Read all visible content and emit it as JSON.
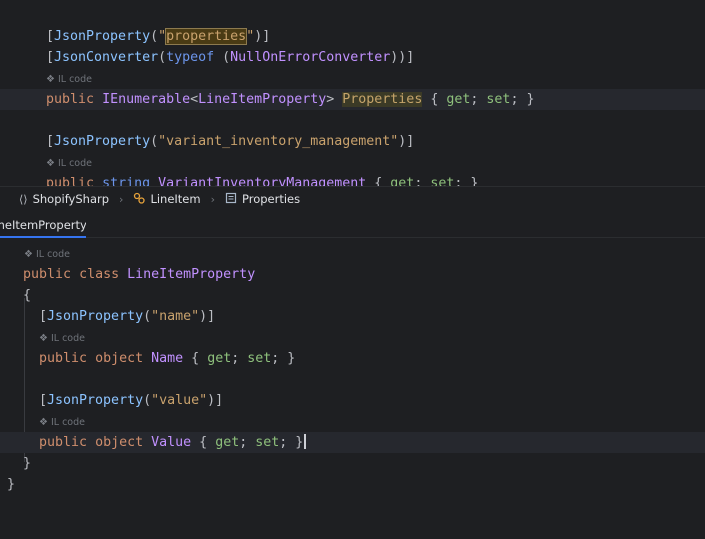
{
  "top_editor": {
    "line1": {
      "attr": "JsonProperty",
      "str_before": "\"",
      "str_hl": "properties",
      "str_after": "\""
    },
    "line2": {
      "attr": "JsonConverter",
      "typeof": "typeof",
      "type": "NullOnErrorConverter"
    },
    "lens1": "IL code",
    "line3": {
      "public": "public",
      "type": "IEnumerable",
      "generic": "LineItemProperty",
      "name": "Properties",
      "get": "get",
      "set": "set"
    },
    "line4": {
      "attr": "JsonProperty",
      "str": "\"variant_inventory_management\""
    },
    "lens2": "IL code",
    "line5": {
      "public": "public",
      "type": "string",
      "name": "VariantInventoryManagement",
      "get": "get",
      "set": "set"
    }
  },
  "breadcrumb": {
    "items": [
      {
        "label": "ShopifySharp",
        "icon": "namespace-icon"
      },
      {
        "label": "LineItem",
        "icon": "class-icon"
      },
      {
        "label": "Properties",
        "icon": "property-icon"
      }
    ],
    "separator": "›"
  },
  "tab": {
    "label": "LineItemProperty.cs",
    "close": "×"
  },
  "bottom_editor": {
    "lens_class": "IL code",
    "class_line": {
      "public": "public",
      "class": "class",
      "name": "LineItemProperty"
    },
    "open_brace": "{",
    "attr1": {
      "attr": "JsonProperty",
      "str": "\"name\""
    },
    "lens1": "IL code",
    "prop1": {
      "public": "public",
      "object": "object",
      "name": "Name",
      "get": "get",
      "set": "set"
    },
    "attr2": {
      "attr": "JsonProperty",
      "str": "\"value\""
    },
    "lens2": "IL code",
    "prop2": {
      "public": "public",
      "object": "object",
      "name": "Value",
      "get": "get",
      "set": "set"
    },
    "close_brace_inner": "}",
    "close_brace_outer": "}"
  },
  "colors": {
    "background": "#1e1f22",
    "keyword": "#cf8e6d",
    "string": "#c9a26d",
    "type": "#c191ff",
    "accent": "#3574f0"
  }
}
